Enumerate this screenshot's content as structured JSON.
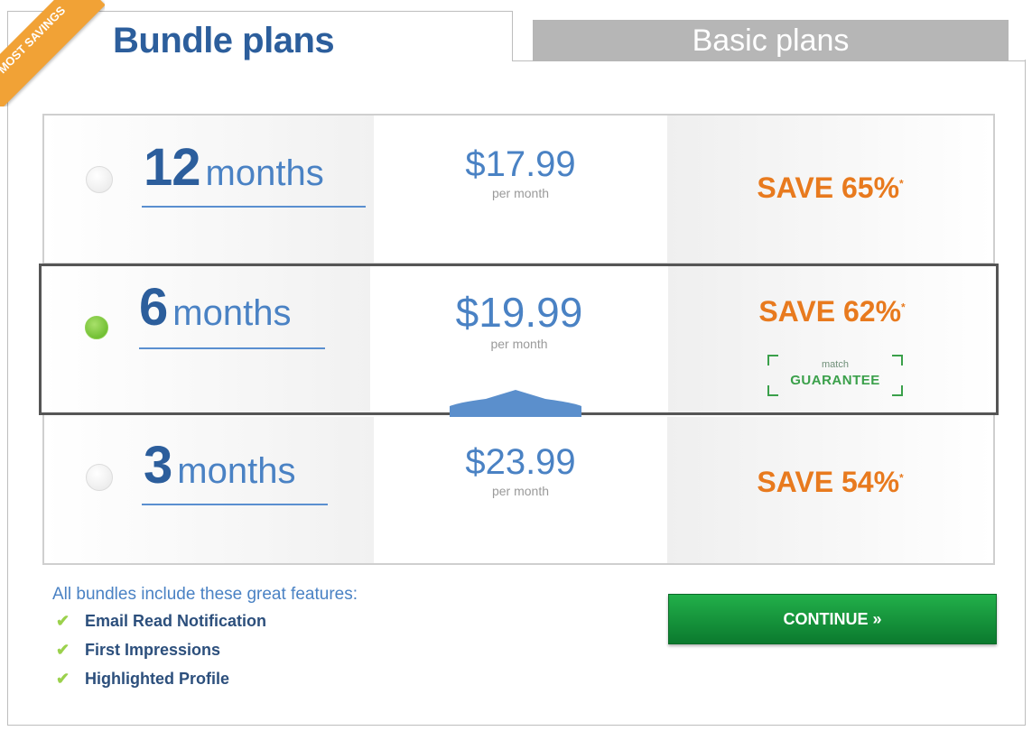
{
  "tabs": {
    "bundle_label": "Bundle plans",
    "basic_label": "Basic plans",
    "ribbon_text": "MOST SAVINGS"
  },
  "plans": [
    {
      "number": "12",
      "unit": "months",
      "price": "$17.99",
      "per": "per month",
      "save": "SAVE 65%",
      "asterisk": "*",
      "selected": false
    },
    {
      "number": "6",
      "unit": "months",
      "price": "$19.99",
      "per": "per month",
      "save": "SAVE 62%",
      "asterisk": "*",
      "selected": true
    },
    {
      "number": "3",
      "unit": "months",
      "price": "$23.99",
      "per": "per month",
      "save": "SAVE 54%",
      "asterisk": "*",
      "selected": false
    }
  ],
  "guarantee": {
    "small": "match",
    "big": "GUARANTEE"
  },
  "features": {
    "title": "All bundles include these great features:",
    "items": [
      "Email Read Notification",
      "First Impressions",
      "Highlighted Profile"
    ]
  },
  "continue_label": "CONTINUE »",
  "colors": {
    "accent": "#2c5e9c",
    "save": "#e87a1e",
    "continue": "#1a9a3e",
    "selected_radio": "#6cc02a"
  }
}
